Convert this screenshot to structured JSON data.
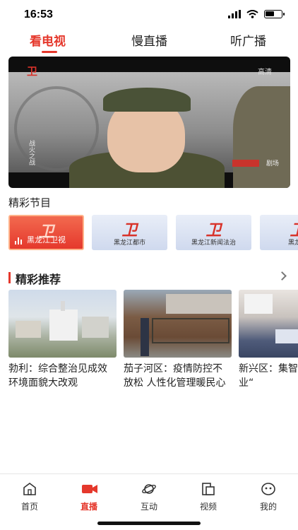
{
  "status_bar": {
    "time": "16:53",
    "battery_level": 0.55
  },
  "top_tabs": [
    {
      "label": "看电视",
      "active": true
    },
    {
      "label": "慢直播",
      "active": false
    },
    {
      "label": "听广播",
      "active": false
    }
  ],
  "player": {
    "logo": "卫",
    "hd_label": "高清",
    "caption": "战火之战",
    "bug": "剧场"
  },
  "programs_section": {
    "title": "精彩节目"
  },
  "channels": [
    {
      "label": "黑龙江卫视",
      "active": true,
      "logo": "卫"
    },
    {
      "label": "黑龙江都市",
      "active": false,
      "logo": "卫"
    },
    {
      "label": "黑龙江新闻法治",
      "active": false,
      "logo": "卫"
    },
    {
      "label": "黑龙江",
      "active": false,
      "logo": "卫"
    }
  ],
  "recommend_section": {
    "title": "精彩推荐"
  },
  "recommendations": [
    {
      "text": "勃利：综合整治见成效 环境面貌大改观"
    },
    {
      "text": "茄子河区：疫情防控不放松 人性化管理暖民心"
    },
    {
      "text": "新兴区：集智好就业创业“"
    }
  ],
  "tabbar": [
    {
      "label": "首页",
      "icon": "home-icon",
      "active": false
    },
    {
      "label": "直播",
      "icon": "live-camera-icon",
      "active": true
    },
    {
      "label": "互动",
      "icon": "planet-icon",
      "active": false
    },
    {
      "label": "视频",
      "icon": "video-doc-icon",
      "active": false
    },
    {
      "label": "我的",
      "icon": "profile-face-icon",
      "active": false
    }
  ],
  "colors": {
    "accent": "#e5382c",
    "text": "#222222"
  }
}
